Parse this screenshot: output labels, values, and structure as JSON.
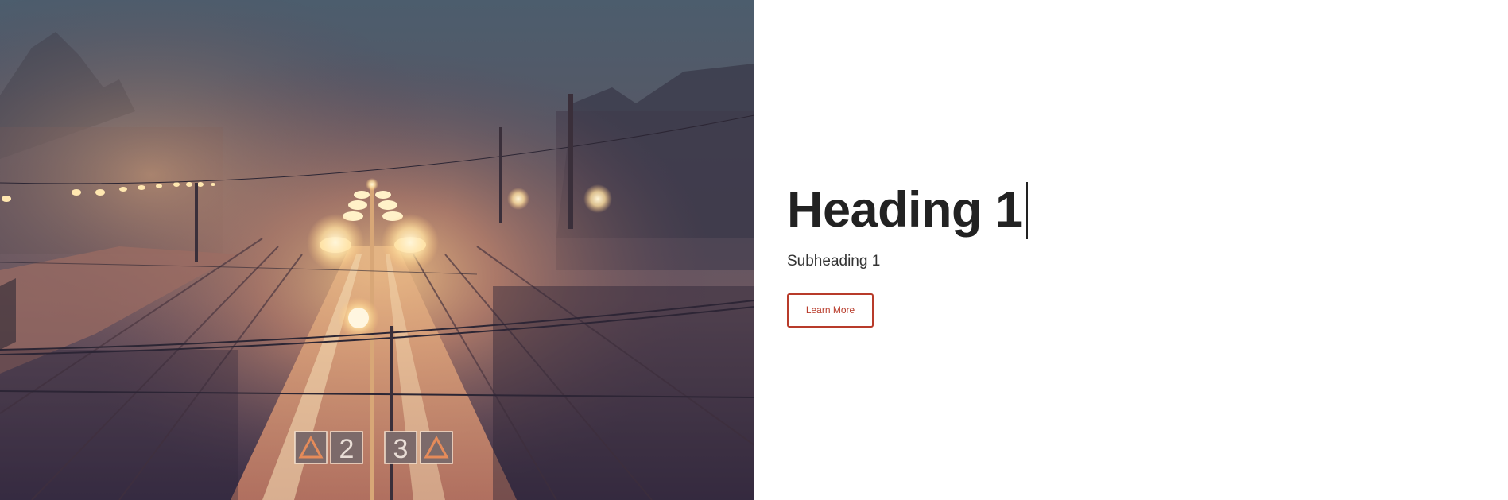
{
  "hero": {
    "image_alt": "Foggy train station at night with platform lamps",
    "platform_signs": [
      "2",
      "3"
    ],
    "heading": "Heading 1",
    "subheading": "Subheading 1",
    "button_label": "Learn More",
    "accent_color": "#b83b2a"
  }
}
